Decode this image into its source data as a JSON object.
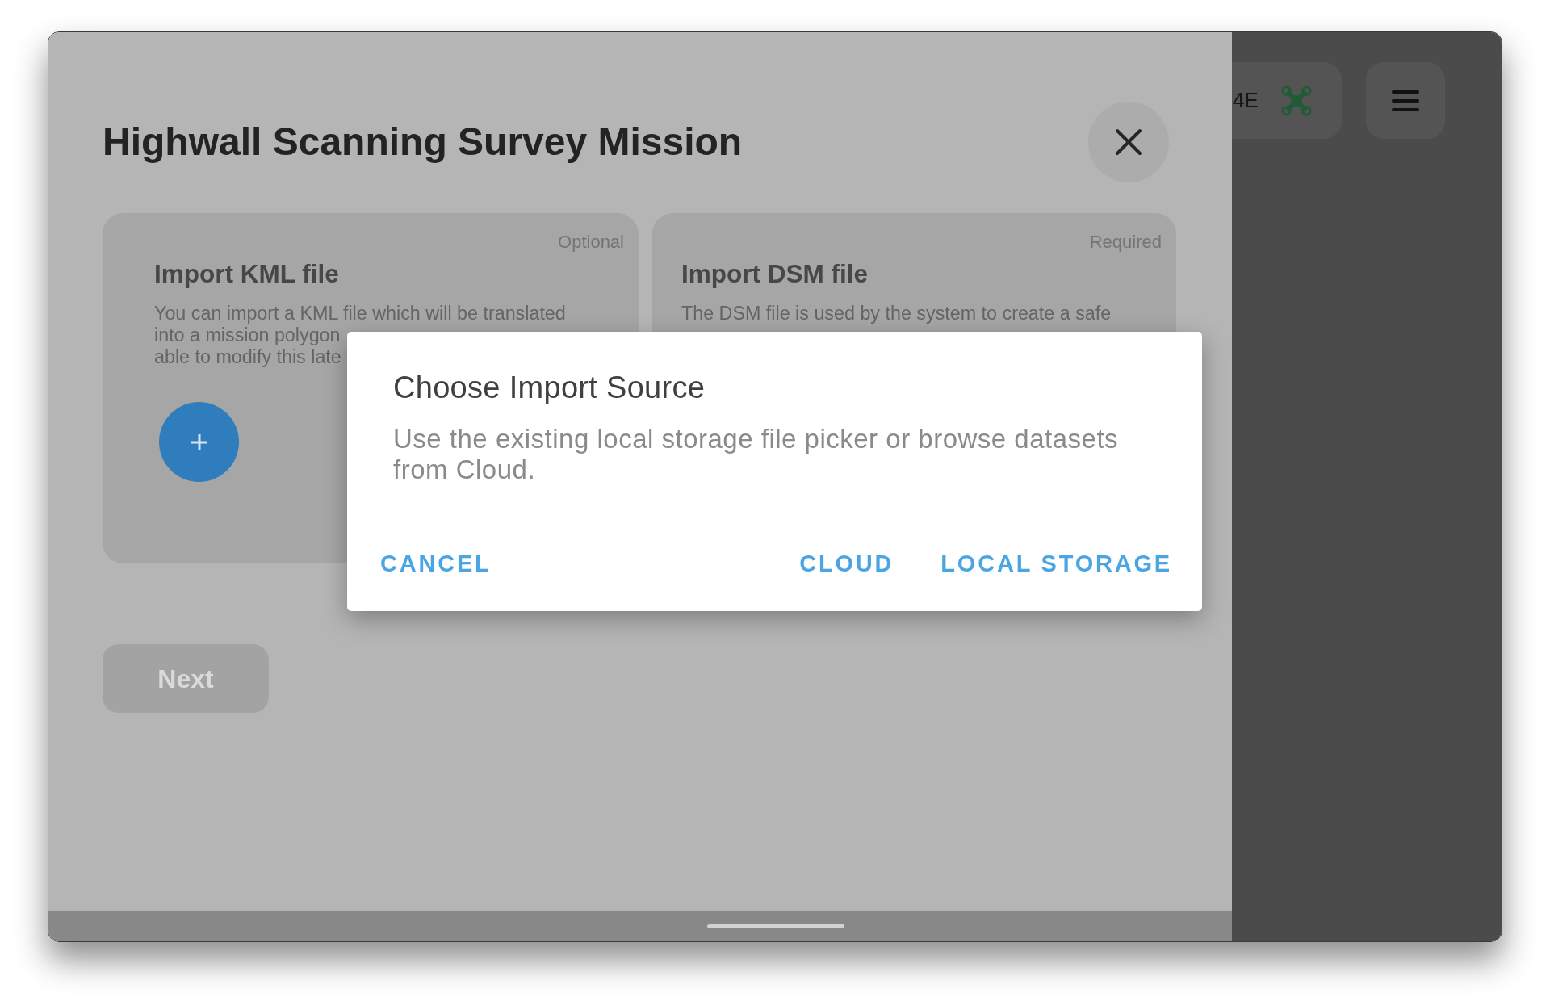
{
  "mission_panel": {
    "title": "Highwall Scanning Survey Mission",
    "cards": [
      {
        "tag": "Optional",
        "title": "Import KML file",
        "description_lines": [
          "You can import a KML file which will be translated",
          "into a mission polygon",
          "able to modify this late"
        ],
        "add_button": true
      },
      {
        "tag": "Required",
        "title": "Import DSM file",
        "description_lines": [
          "The DSM file is used by the system to create a safe"
        ]
      }
    ],
    "next_button": {
      "label": "Next",
      "disabled": true
    }
  },
  "side_panel": {
    "drone_label": "4E"
  },
  "dialog": {
    "title": "Choose Import Source",
    "message": "Use the existing local storage file picker or browse datasets from Cloud.",
    "neutral_action": "CANCEL",
    "actions": [
      "CLOUD",
      "LOCAL STORAGE"
    ]
  }
}
